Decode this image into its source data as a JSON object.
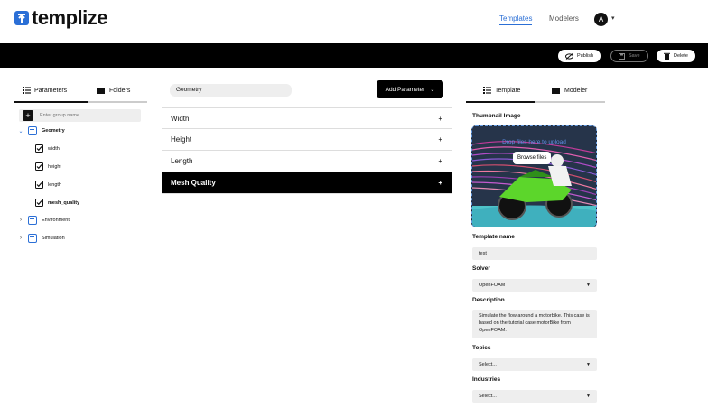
{
  "app": {
    "name": "templize"
  },
  "nav": {
    "templates": "Templates",
    "modelers": "Modelers",
    "avatar_letter": "A"
  },
  "toolbar": {
    "publish": "Publish",
    "save": "Save",
    "delete": "Delete"
  },
  "left": {
    "tab_parameters": "Parameters",
    "tab_folders": "Folders",
    "group_search_placeholder": "Enter group name ...",
    "tree": [
      {
        "label": "Geometry",
        "expanded": true,
        "children": [
          "width",
          "height",
          "length",
          "mesh_quality"
        ]
      },
      {
        "label": "Environment",
        "expanded": false
      },
      {
        "label": "Simulation",
        "expanded": false
      }
    ]
  },
  "center": {
    "breadcrumb": "Geometry",
    "add_parameter": "Add Parameter",
    "params": [
      "Width",
      "Height",
      "Length",
      "Mesh Quality"
    ]
  },
  "right": {
    "tab_template": "Template",
    "tab_modeler": "Modeler",
    "thumbnail_label": "Thumbnail Image",
    "drop_text": "Drop files here to upload",
    "browse_button": "Browse files",
    "template_name_label": "Template name",
    "template_name_value": "test",
    "solver_label": "Solver",
    "solver_value": "OpenFOAM",
    "description_label": "Description",
    "description_value": "Simulate the flow around a motorbike. This case is based on the tutorial case motorBike from OpenFOAM.",
    "topics_label": "Topics",
    "topics_placeholder": "Select...",
    "industries_label": "Industries",
    "industries_placeholder": "Select..."
  },
  "colors": {
    "accent": "#2b6fd6",
    "bar": "#000000",
    "selected_row": "#000000"
  }
}
